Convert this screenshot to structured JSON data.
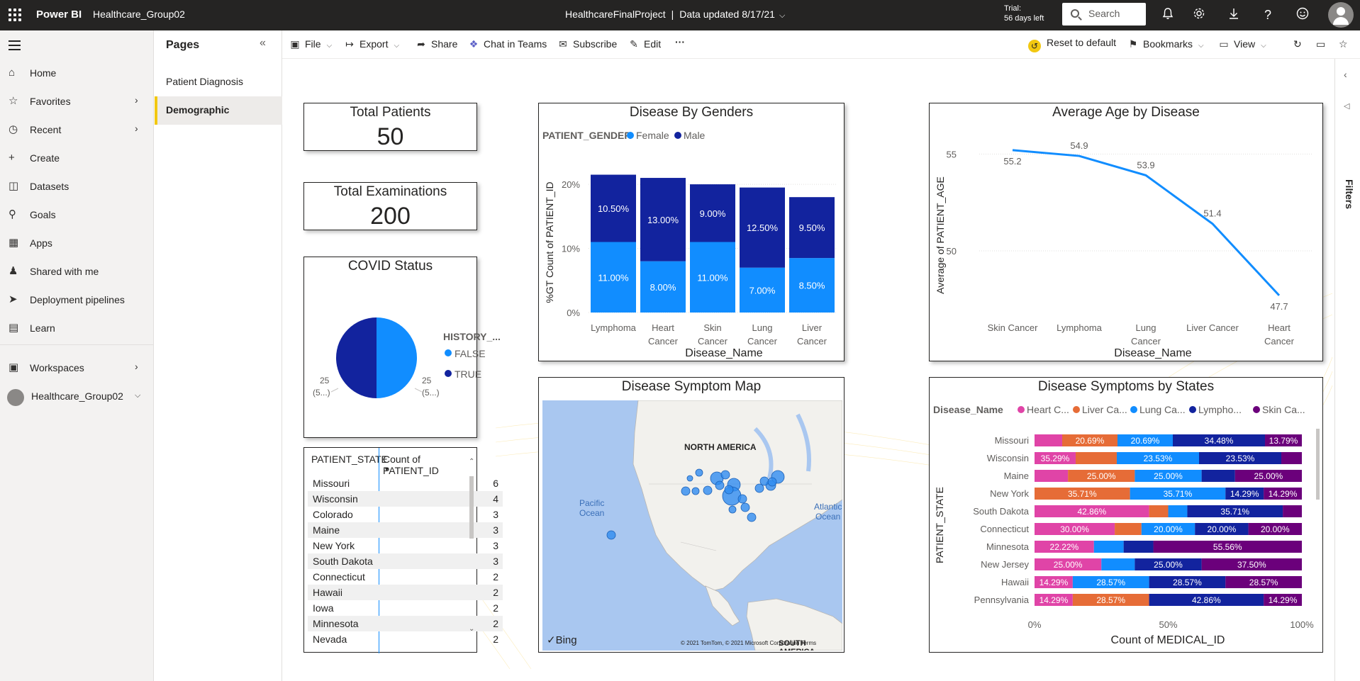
{
  "topbar": {
    "brand": "Power BI",
    "workspace": "Healthcare_Group02",
    "report_name": "HealthcareFinalProject",
    "separator": "|",
    "data_updated": "Data updated 8/17/21",
    "trial_line1": "Trial:",
    "trial_line2": "56 days left",
    "search_placeholder": "Search"
  },
  "leftnav": {
    "items": [
      {
        "label": "Home",
        "icon": "home-icon"
      },
      {
        "label": "Favorites",
        "icon": "star-icon"
      },
      {
        "label": "Recent",
        "icon": "clock-icon"
      },
      {
        "label": "Create",
        "icon": "plus-icon"
      },
      {
        "label": "Datasets",
        "icon": "database-icon"
      },
      {
        "label": "Goals",
        "icon": "trophy-icon"
      },
      {
        "label": "Apps",
        "icon": "apps-icon"
      },
      {
        "label": "Shared with me",
        "icon": "shared-icon"
      },
      {
        "label": "Deployment pipelines",
        "icon": "rocket-icon"
      },
      {
        "label": "Learn",
        "icon": "book-icon"
      },
      {
        "label": "Workspaces",
        "icon": "workspaces-icon"
      },
      {
        "label": "Healthcare_Group02",
        "icon": "workspace-avatar-icon"
      }
    ]
  },
  "pages": {
    "title": "Pages",
    "items": [
      "Patient Diagnosis",
      "Demographic"
    ],
    "active": "Demographic"
  },
  "actionbar": {
    "file": "File",
    "export": "Export",
    "share": "Share",
    "chat": "Chat in Teams",
    "subscribe": "Subscribe",
    "edit": "Edit",
    "more": "···",
    "reset": "Reset to default",
    "bookmarks": "Bookmarks",
    "view": "View"
  },
  "filters": {
    "label": "Filters"
  },
  "cards": {
    "total_patients": {
      "title": "Total Patients",
      "value": "50"
    },
    "total_exams": {
      "title": "Total Examinations",
      "value": "200"
    }
  },
  "covid": {
    "title": "COVID Status",
    "legend_title": "HISTORY_...",
    "legend": [
      "FALSE",
      "TRUE"
    ],
    "label_left": [
      "25",
      "(5...)"
    ],
    "label_right": [
      "25",
      "(5...)"
    ]
  },
  "state_table": {
    "headers": [
      "PATIENT_STATE",
      "Count of PATIENT_ID"
    ],
    "rows": [
      [
        "Missouri",
        "6"
      ],
      [
        "Wisconsin",
        "4"
      ],
      [
        "Colorado",
        "3"
      ],
      [
        "Maine",
        "3"
      ],
      [
        "New York",
        "3"
      ],
      [
        "South Dakota",
        "3"
      ],
      [
        "Connecticut",
        "2"
      ],
      [
        "Hawaii",
        "2"
      ],
      [
        "Iowa",
        "2"
      ],
      [
        "Minnesota",
        "2"
      ],
      [
        "Nevada",
        "2"
      ]
    ]
  },
  "map": {
    "title": "Disease Symptom Map",
    "labels": {
      "north_america": "NORTH AMERICA",
      "pacific": [
        "Pacific",
        "Ocean"
      ],
      "atlantic": [
        "Atlantic",
        "Ocean"
      ],
      "south_america": "SOUTH AMERICA",
      "bing": "Bing",
      "copyright": "© 2021 TomTom, © 2021 Microsoft Corporation",
      "terms": "Terms"
    },
    "colors": {
      "water": "#a9c7f0",
      "land": "#f2f1ed",
      "bubble": "#2f8cf0"
    }
  },
  "chart_data": [
    {
      "type": "bar",
      "stacked": true,
      "title": "Disease By Genders",
      "legend_title": "PATIENT_GENDER",
      "xlabel": "Disease_Name",
      "ylabel": "%GT Count of PATIENT_ID",
      "categories": [
        "Lymphoma",
        "Heart Cancer",
        "Skin Cancer",
        "Lung Cancer",
        "Liver Cancer"
      ],
      "series": [
        {
          "name": "Female",
          "color": "#118dff",
          "values": [
            11.0,
            8.0,
            11.0,
            7.0,
            8.5
          ],
          "labels": [
            "11.00%",
            "8.00%",
            "11.00%",
            "7.00%",
            "8.50%"
          ]
        },
        {
          "name": "Male",
          "color": "#12239e",
          "values": [
            10.5,
            13.0,
            9.0,
            12.5,
            9.5
          ],
          "labels": [
            "10.50%",
            "13.00%",
            "9.00%",
            "12.50%",
            "9.50%"
          ]
        }
      ],
      "yticks": [
        "0%",
        "10%",
        "20%"
      ],
      "ylim": [
        0,
        22
      ],
      "grid": true
    },
    {
      "type": "line",
      "title": "Average Age by Disease",
      "xlabel": "Disease_Name",
      "ylabel": "Average of PATIENT_AGE",
      "categories": [
        "Skin Cancer",
        "Lymphoma",
        "Lung Cancer",
        "Liver Cancer",
        "Heart Cancer"
      ],
      "values": [
        55.2,
        54.9,
        53.9,
        51.4,
        47.7
      ],
      "labels": [
        "55.2",
        "54.9",
        "53.9",
        "51.4",
        "47.7"
      ],
      "yticks": [
        "50",
        "55"
      ],
      "ylim": [
        47,
        56
      ],
      "color": "#118dff",
      "grid": true
    },
    {
      "type": "bar",
      "orientation": "horizontal",
      "stacked": "100%",
      "title": "Disease Symptoms by States",
      "legend_title": "Disease_Name",
      "legend": [
        "Heart C...",
        "Liver Ca...",
        "Lung Ca...",
        "Lympho...",
        "Skin Ca..."
      ],
      "xlabel": "Count of MEDICAL_ID",
      "ylabel": "PATIENT_STATE",
      "xticks": [
        "0%",
        "50%",
        "100%"
      ],
      "categories": [
        "Missouri",
        "Wisconsin",
        "Maine",
        "New York",
        "South Dakota",
        "Connecticut",
        "Minnesota",
        "New Jersey",
        "Hawaii",
        "Pennsylvania"
      ],
      "series": [
        {
          "name": "Heart Cancer",
          "color": "#e044a7",
          "values": [
            10.34,
            11.76,
            12.5,
            0,
            42.86,
            30.0,
            22.22,
            25.0,
            14.29,
            14.29
          ],
          "labels": [
            "",
            "35.29%",
            "",
            "",
            "42.86%",
            "30.00%",
            "22.22%",
            "25.00%",
            "14.29%",
            "14.29%"
          ]
        },
        {
          "name": "Liver Cancer",
          "color": "#e66c37",
          "values": [
            20.69,
            11.76,
            25.0,
            35.71,
            7.14,
            10.0,
            0,
            0,
            0,
            28.57
          ],
          "labels": [
            "20.69%",
            "",
            "25.00%",
            "35.71%",
            "",
            "",
            "",
            "",
            "",
            "28.57%"
          ]
        },
        {
          "name": "Lung Cancer",
          "color": "#118dff",
          "values": [
            20.69,
            23.53,
            25.0,
            35.71,
            7.14,
            20.0,
            11.11,
            12.5,
            28.57,
            0
          ],
          "labels": [
            "20.69%",
            "23.53%",
            "25.00%",
            "35.71%",
            "",
            "20.00%",
            "",
            "",
            "28.57%",
            ""
          ],
          "label_over": [
            false,
            false,
            false,
            false,
            false,
            false,
            false,
            false,
            false,
            false
          ]
        },
        {
          "name": "Lymphoma",
          "color": "#12239e",
          "values": [
            34.48,
            23.53,
            12.5,
            14.29,
            35.71,
            20.0,
            11.11,
            25.0,
            28.57,
            42.86
          ],
          "labels": [
            "34.48%",
            "23.53%",
            "",
            "14.29%",
            "35.71%",
            "20.00%",
            "",
            "25.00%",
            "28.57%",
            "42.86%"
          ]
        },
        {
          "name": "Skin Cancer",
          "color": "#6b007b",
          "values": [
            13.79,
            5.88,
            25.0,
            14.29,
            7.14,
            20.0,
            55.56,
            37.5,
            28.57,
            14.29
          ],
          "labels": [
            "13.79%",
            "",
            "25.00%",
            "14.29%",
            "",
            "20.00%",
            "55.56%",
            "37.50%",
            "28.57%",
            "14.29%"
          ]
        }
      ]
    }
  ]
}
